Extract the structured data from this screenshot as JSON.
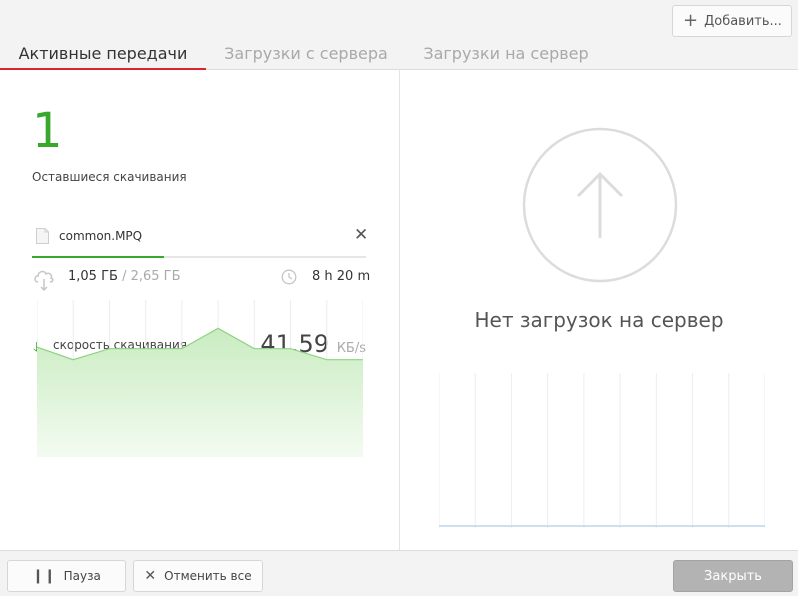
{
  "toolbar": {
    "add_label": "Добавить...",
    "add_icon": "plus-icon"
  },
  "tabs": [
    {
      "label": "Активные передачи",
      "active": true
    },
    {
      "label": "Загрузки с сервера",
      "active": false
    },
    {
      "label": "Загрузки на сервер",
      "active": false
    }
  ],
  "downloads": {
    "remaining_count": "1",
    "remaining_label": "Оставшиеся скачивания",
    "file": {
      "name": "common.MPQ",
      "downloaded": "1,05 ГБ",
      "total": "/ 2,65 ГБ",
      "progress": 0.396,
      "eta": "8 h 20 m"
    },
    "speed_label": "скорость скачивания",
    "speed_value": "41,59",
    "speed_unit": "КБ/s",
    "speed_history": [
      41.0,
      40.2,
      40.9,
      40.9,
      40.9,
      42.2,
      40.9,
      40.9,
      40.2,
      40.2
    ],
    "speed_scale": [
      34,
      44
    ],
    "accent_color": "#37a82c"
  },
  "uploads": {
    "empty_label": "Нет загрузок на сервер",
    "icon": "arrow-up-circle-icon"
  },
  "footer": {
    "pause_label": "Пауза",
    "cancel_all_label": "Отменить все",
    "close_label": "Закрыть"
  }
}
